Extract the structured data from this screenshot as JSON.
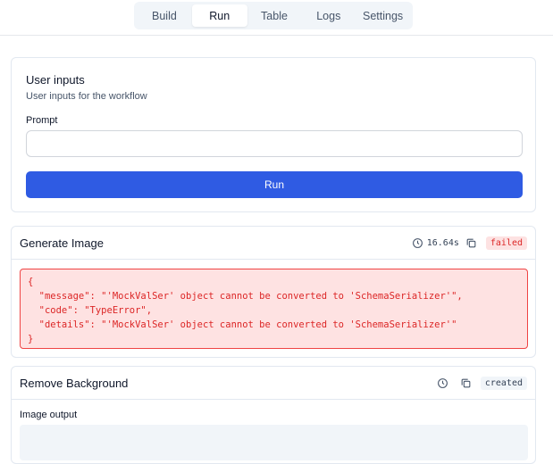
{
  "tabs": [
    {
      "label": "Build"
    },
    {
      "label": "Run",
      "active": true
    },
    {
      "label": "Table"
    },
    {
      "label": "Logs"
    },
    {
      "label": "Settings"
    }
  ],
  "inputs_card": {
    "title": "User inputs",
    "subtitle": "User inputs for the workflow",
    "prompt_label": "Prompt",
    "prompt_value": "",
    "run_label": "Run"
  },
  "generate_image": {
    "title": "Generate Image",
    "duration": "16.64s",
    "status": "failed",
    "error_lines": [
      "{",
      "  \"message\": \"'MockValSer' object cannot be converted to 'SchemaSerializer'\",",
      "  \"code\": \"TypeError\",",
      "  \"details\": \"'MockValSer' object cannot be converted to 'SchemaSerializer'\"",
      "}"
    ]
  },
  "remove_background": {
    "title": "Remove Background",
    "status": "created",
    "output_label": "Image output"
  },
  "icons": {
    "clock": "clock-icon",
    "copy": "copy-icon"
  },
  "colors": {
    "accent": "#2f5be3",
    "error_bg": "#fee2e2",
    "error_text": "#dc2626",
    "border": "#e2e8f0"
  }
}
